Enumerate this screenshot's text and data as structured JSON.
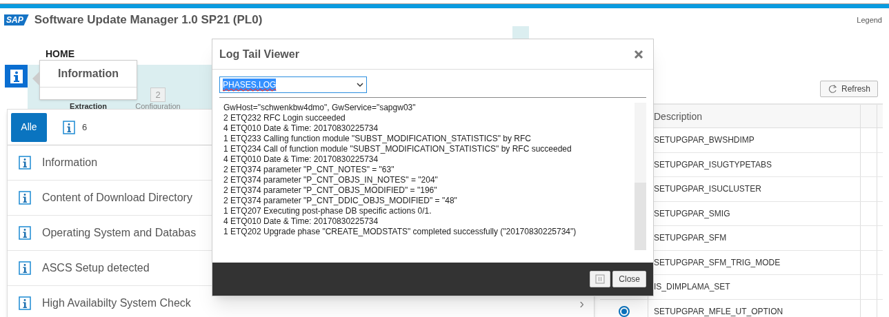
{
  "header": {
    "logo": "SAP",
    "title": "Software Update Manager 1.0 SP21 (PL0)",
    "legend": "Legend"
  },
  "nav": {
    "home": "HOME",
    "steps": [
      {
        "label": "Extraction"
      },
      {
        "number": "2",
        "label": "Configuration"
      }
    ]
  },
  "popover": {
    "title": "Information"
  },
  "messages": {
    "filter": {
      "label": "Alle",
      "selected": true
    },
    "count": "6",
    "items": [
      {
        "text": "Information"
      },
      {
        "text": "Content of Download Directory"
      },
      {
        "text": "Operating System and Databas"
      },
      {
        "text": "ASCS Setup detected"
      },
      {
        "text": "High Availabilty System Check",
        "chevron": "›"
      }
    ]
  },
  "table": {
    "refresh": "Refresh",
    "columns": [
      "Description"
    ],
    "rows": [
      {
        "description": "SETUPGPAR_BWSHDIMP"
      },
      {
        "description": "SETUPGPAR_ISUGTYPETABS"
      },
      {
        "description": "SETUPGPAR_ISUCLUSTER"
      },
      {
        "description": "SETUPGPAR_SMIG"
      },
      {
        "description": "SETUPGPAR_SFM"
      },
      {
        "description": "SETUPGPAR_SFM_TRIG_MODE"
      },
      {
        "description": "IS_DIMPLAMA_SET"
      },
      {
        "description": "SETUPGPAR_MFLE_UT_OPTION",
        "selected": true
      }
    ]
  },
  "dialog": {
    "title": "Log Tail Viewer",
    "file": "PHASES.LOG",
    "log": [
      "GwHost=\"schwenkbw4dmo\", GwService=\"sapgw03\"",
      "2 ETQ232 RFC Login succeeded",
      "4 ETQ010 Date & Time: 20170830225734",
      "1 ETQ233 Calling function module \"SUBST_MODIFICATION_STATISTICS\" by RFC",
      "1 ETQ234 Call of function module \"SUBST_MODIFICATION_STATISTICS\" by RFC succeeded",
      "4 ETQ010 Date & Time: 20170830225734",
      "2 ETQ374 parameter \"P_CNT_NOTES\" = \"63\"",
      "2 ETQ374 parameter \"P_CNT_OBJS_IN_NOTES\" = \"204\"",
      "2 ETQ374 parameter \"P_CNT_OBJS_MODIFIED\" = \"196\"",
      "2 ETQ374 parameter \"P_CNT_DDIC_OBJS_MODIFIED\" = \"48\"",
      "1 ETQ207 Executing post-phase DB specific actions 0/1.",
      "4 ETQ010 Date & Time: 20170830225734",
      "1 ETQ202 Upgrade phase \"CREATE_MODSTATS\" completed successfully (\"20170830225734\")"
    ],
    "close": "Close"
  }
}
